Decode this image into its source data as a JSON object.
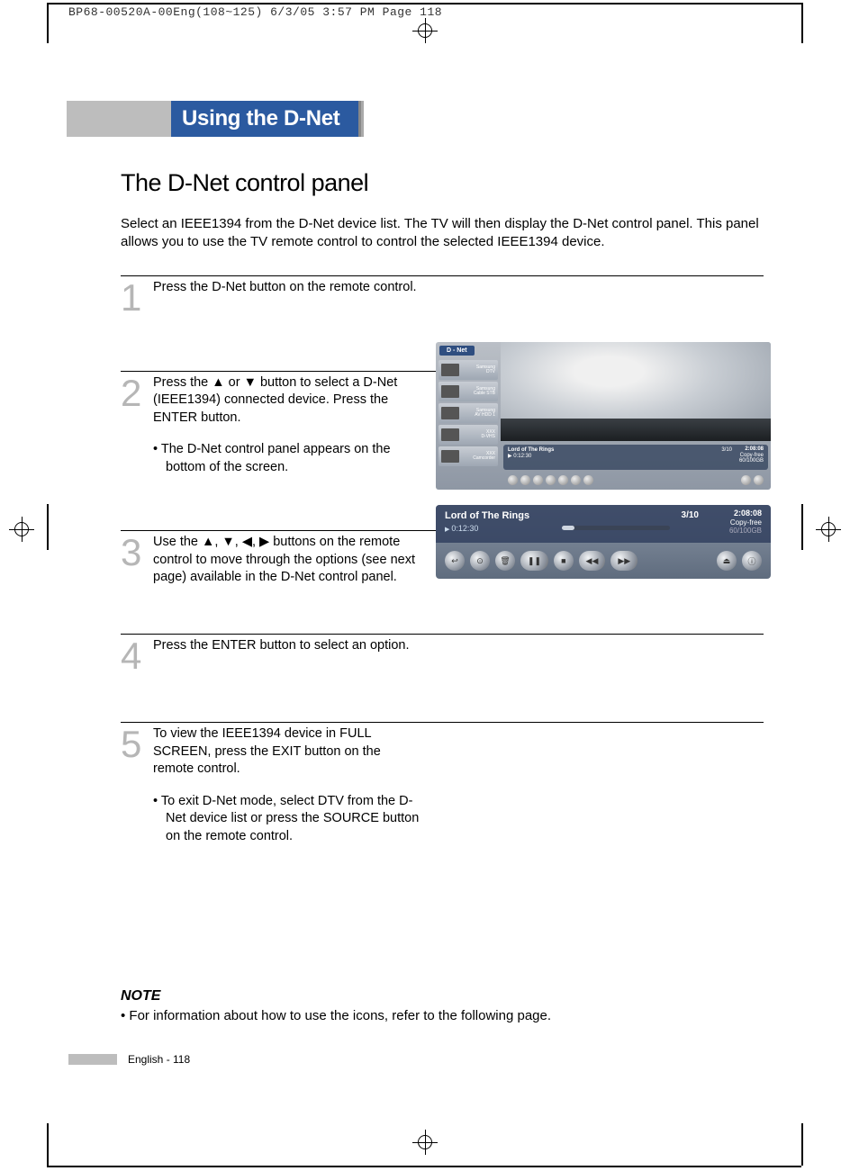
{
  "meta_header": "BP68-00520A-00Eng(108~125)  6/3/05  3:57 PM  Page 118",
  "title": "Using the D-Net",
  "subtitle": "The D-Net control panel",
  "intro": "Select an IEEE1394 from the D-Net device list. The TV will then display the D-Net control panel. This panel allows you to use the TV remote control to control the selected IEEE1394 device.",
  "steps": [
    {
      "num": "1",
      "text": "Press the D-Net button on the remote control.",
      "bullet": ""
    },
    {
      "num": "2",
      "text": "Press the ▲ or ▼ button to select a D-Net (IEEE1394) connected device. Press the ENTER button.",
      "bullet": "The D-Net control panel appears on the bottom of the screen."
    },
    {
      "num": "3",
      "text": "Use the ▲, ▼, ◀, ▶ buttons on the remote control to move through the options (see next page) available in the D-Net control panel.",
      "bullet": ""
    },
    {
      "num": "4",
      "text": "Press the ENTER button to select an option.",
      "bullet": ""
    },
    {
      "num": "5",
      "text": "To view the IEEE1394 device in FULL SCREEN, press the EXIT button on the remote control.",
      "bullet": "To exit D-Net mode, select DTV from the D-Net device list or press the SOURCE button on the remote control."
    }
  ],
  "note_head": "NOTE",
  "note_body": "•  For information about how to use the icons, refer to the following page.",
  "footer": "English - 118",
  "screenshot_a": {
    "header": "D - Net",
    "devices": [
      {
        "brand": "Samsung",
        "name": "DTV"
      },
      {
        "brand": "Samsung",
        "name": "Cable STB"
      },
      {
        "brand": "Samsung",
        "name": "AV HDD 1"
      },
      {
        "brand": "XXX",
        "name": "D-VHS"
      },
      {
        "brand": "XXX",
        "name": "Camcorder"
      }
    ],
    "panel": {
      "title": "Lord of The Rings",
      "elapsed": "0:12:30",
      "count": "3/10",
      "duration": "2:08:08",
      "copy": "Copy-free",
      "storage": "60/100GB"
    }
  },
  "screenshot_b": {
    "title": "Lord of The Rings",
    "elapsed": "0:12:30",
    "count": "3/10",
    "duration": "2:08:08",
    "copy": "Copy-free",
    "storage": "60/100GB",
    "controls": [
      "↩",
      "⊙",
      "🗑",
      "❚❚",
      "■",
      "◀◀",
      "▶▶"
    ],
    "controls_right": [
      "⏏",
      "ⓘ"
    ]
  }
}
